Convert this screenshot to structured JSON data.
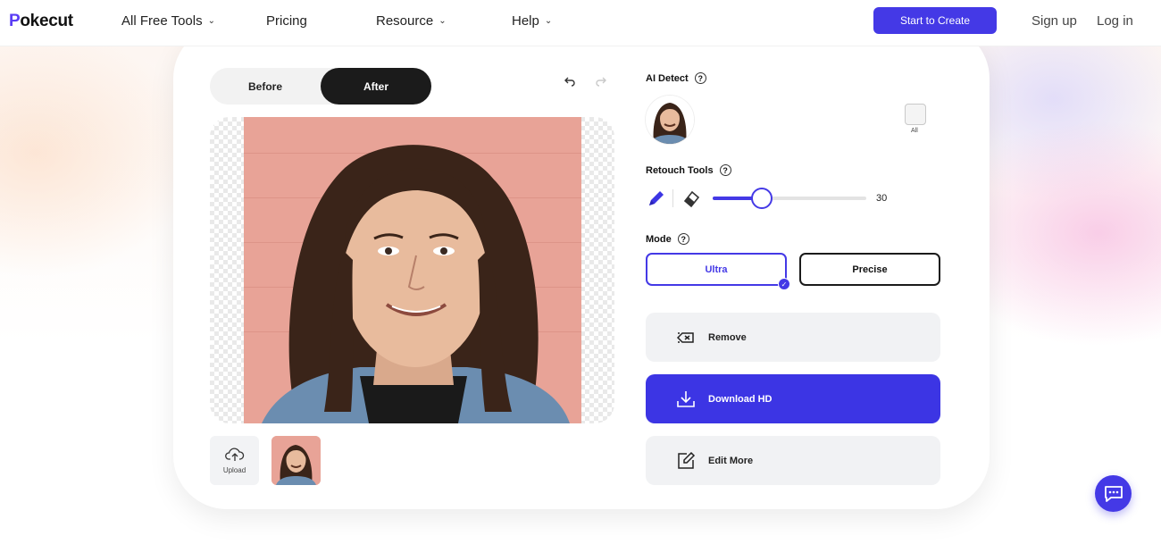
{
  "nav": {
    "logo": "okecut",
    "logo_mark": "P",
    "items": [
      {
        "label": "All Free Tools",
        "has_dropdown": true
      },
      {
        "label": "Pricing",
        "has_dropdown": false
      },
      {
        "label": "Resource",
        "has_dropdown": true
      },
      {
        "label": "Help",
        "has_dropdown": true
      }
    ],
    "cta_label": "Start to Create",
    "signup_label": "Sign up",
    "login_label": "Log in"
  },
  "editor": {
    "toggle": {
      "before_label": "Before",
      "after_label": "After",
      "selected": "After"
    },
    "upload_label": "Upload"
  },
  "panel": {
    "ai_detect_label": "AI Detect",
    "all_label": "All",
    "retouch_label": "Retouch Tools",
    "brush_size": 30,
    "brush_size_text": "30",
    "brush_fraction": 0.32,
    "mode_label": "Mode",
    "mode_options": [
      "Ultra",
      "Precise"
    ],
    "mode_selected": "Ultra",
    "remove_label": "Remove",
    "download_label": "Download HD",
    "edit_label": "Edit More"
  },
  "colors": {
    "accent": "#4439e6",
    "dark": "#1b1b1b",
    "photo_bg": "#e8a397"
  },
  "icons": [
    "chevron-down-icon",
    "undo-icon",
    "redo-icon",
    "help-icon",
    "pencil-icon",
    "eraser-icon",
    "check-icon",
    "remove-icon",
    "download-icon",
    "edit-icon",
    "upload-icon",
    "chat-icon"
  ]
}
